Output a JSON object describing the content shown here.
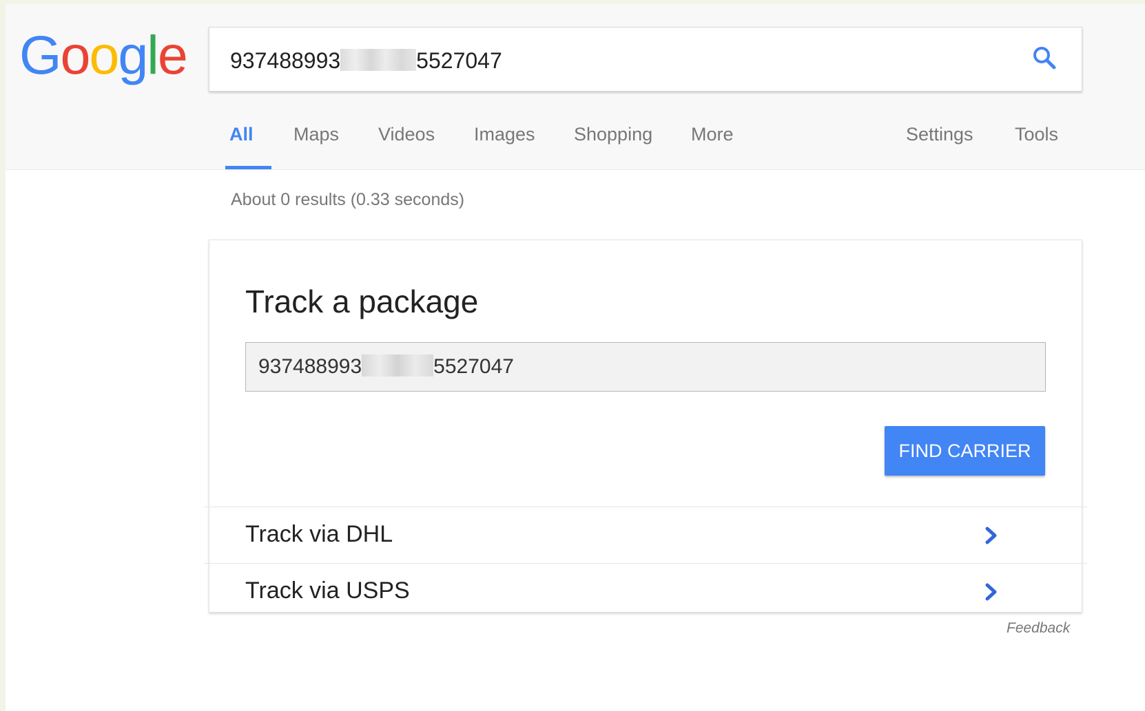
{
  "logo": {
    "letters": [
      "G",
      "o",
      "o",
      "g",
      "l",
      "e"
    ],
    "colors": [
      "#4285f4",
      "#ea4335",
      "#fbbc05",
      "#4285f4",
      "#34a853",
      "#ea4335"
    ]
  },
  "search": {
    "value_prefix": "937488993",
    "value_suffix": "5527047",
    "icon": "search-icon"
  },
  "tabs": [
    {
      "label": "All",
      "active": true
    },
    {
      "label": "Maps",
      "active": false
    },
    {
      "label": "Videos",
      "active": false
    },
    {
      "label": "Images",
      "active": false
    },
    {
      "label": "Shopping",
      "active": false
    },
    {
      "label": "More",
      "active": false
    }
  ],
  "right_tabs": [
    {
      "label": "Settings"
    },
    {
      "label": "Tools"
    }
  ],
  "results_stats": "About 0 results (0.33 seconds)",
  "card": {
    "title": "Track a package",
    "tracking_prefix": "937488993",
    "tracking_suffix": "5527047",
    "button_label": "FIND CARRIER",
    "rows": [
      {
        "label": "Track via DHL",
        "icon": "chevron-right-icon"
      },
      {
        "label": "Track via USPS",
        "icon": "chevron-right-icon"
      }
    ]
  },
  "feedback": "Feedback",
  "colors": {
    "accent": "#4285f4",
    "chevron": "#3367d6"
  }
}
